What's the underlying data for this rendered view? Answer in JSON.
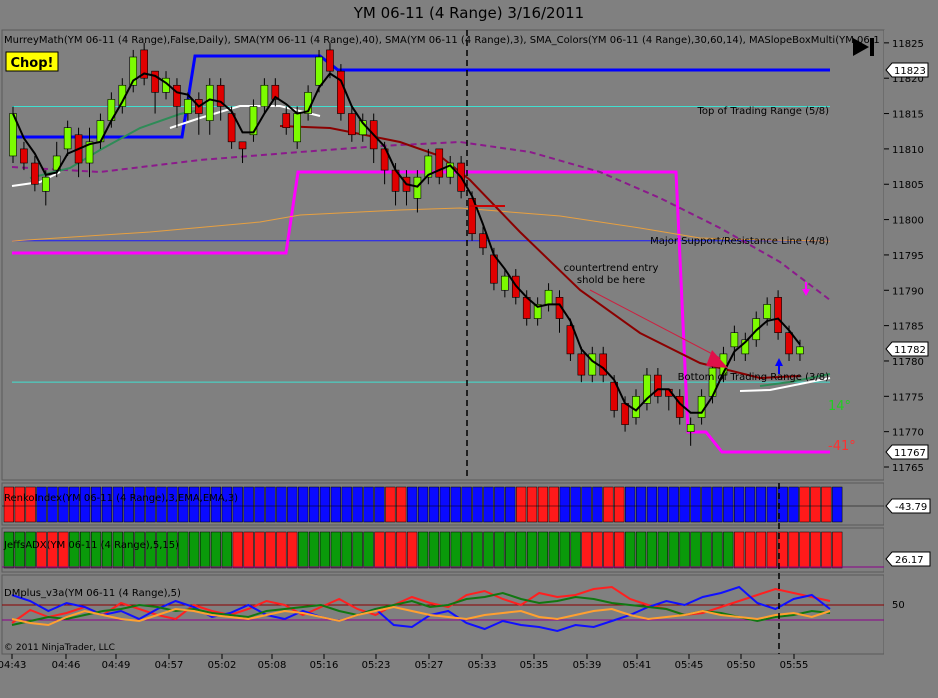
{
  "window": {
    "title": "YM 06-11 (4 Range)  3/16/2011"
  },
  "price_panel": {
    "indicator_label": "MurreyMath(YM 06-11 (4 Range),False,Daily), SMA(YM 06-11 (4 Range),40), SMA(YM 06-11 (4 Range),3), SMA_Colors(YM 06-11 (4 Range),30,60,14), MASlopeBoxMulti(YM 06-1",
    "chop_label": "Chop!",
    "top_range_label": "Top of Trading Range (5/8)",
    "major_sr_label": "Major Support/Resistance Line (4/8)",
    "bottom_range_label": "Bottom of Trading Range (3/8)",
    "annotation_line1": "countertrend entry",
    "annotation_line2": "shold be here",
    "slope_label_green": "14°",
    "slope_label_red": "-41°",
    "current_price_tags": [
      "11823",
      "11782",
      "11767"
    ]
  },
  "panel2": {
    "label": "RenkoIndex(YM 06-11 (4 Range),3,EMA,EMA,3)",
    "value_tag": "-43.79"
  },
  "panel3": {
    "label": "JeffsADX(YM 06-11 (4 Range),5,15)",
    "value_tag": "26.17"
  },
  "panel4": {
    "label": "DMplus_v3a(YM 06-11 (4 Range),5)",
    "scale_label": "50",
    "copyright": "© 2011 NinjaTrader, LLC"
  },
  "colors": {
    "background": "#808080",
    "up_candle": "#7CFC00",
    "down_candle": "#E00000",
    "murrey_blue": "#0000FF",
    "magenta": "#FF00FF",
    "cyan": "#40E0D0"
  },
  "chart_data": {
    "type": "candlestick",
    "title": "YM 06-11 (4 Range)  3/16/2011",
    "y_ticks": [
      11825,
      11820,
      11815,
      11810,
      11805,
      11800,
      11795,
      11790,
      11785,
      11780,
      11775,
      11770,
      11765
    ],
    "ylim": [
      11764,
      11828
    ],
    "x_ticks": [
      "04:43",
      "04:46",
      "04:49",
      "04:57",
      "05:02",
      "05:08",
      "05:16",
      "05:23",
      "05:27",
      "05:33",
      "05:35",
      "05:39",
      "05:41",
      "05:45",
      "05:50",
      "05:55"
    ],
    "levels": {
      "top_of_trading_range": 11816,
      "major_support_resistance": 11797,
      "bottom_of_trading_range": 11777
    },
    "bars": [
      {
        "o": 11809,
        "c": 11815,
        "h": 11816,
        "l": 11808
      },
      {
        "o": 11810,
        "c": 11808,
        "h": 11811,
        "l": 11807
      },
      {
        "o": 11808,
        "c": 11805,
        "h": 11809,
        "l": 11804
      },
      {
        "o": 11804,
        "c": 11806,
        "h": 11807,
        "l": 11802
      },
      {
        "o": 11807,
        "c": 11809,
        "h": 11811,
        "l": 11806
      },
      {
        "o": 11810,
        "c": 11813,
        "h": 11814,
        "l": 11809
      },
      {
        "o": 11812,
        "c": 11808,
        "h": 11813,
        "l": 11806
      },
      {
        "o": 11808,
        "c": 11811,
        "h": 11813,
        "l": 11806
      },
      {
        "o": 11811,
        "c": 11814,
        "h": 11815,
        "l": 11810
      },
      {
        "o": 11814,
        "c": 11817,
        "h": 11818,
        "l": 11813
      },
      {
        "o": 11816,
        "c": 11819,
        "h": 11820,
        "l": 11815
      },
      {
        "o": 11819,
        "c": 11823,
        "h": 11824,
        "l": 11818
      },
      {
        "o": 11824,
        "c": 11820,
        "h": 11825,
        "l": 11819
      },
      {
        "o": 11821,
        "c": 11818,
        "h": 11821,
        "l": 11815
      },
      {
        "o": 11818,
        "c": 11820,
        "h": 11821,
        "l": 11817
      },
      {
        "o": 11819,
        "c": 11816,
        "h": 11820,
        "l": 11813
      },
      {
        "o": 11815,
        "c": 11817,
        "h": 11818,
        "l": 11814
      },
      {
        "o": 11817,
        "c": 11815,
        "h": 11818,
        "l": 11812
      },
      {
        "o": 11814,
        "c": 11819,
        "h": 11820,
        "l": 11812
      },
      {
        "o": 11819,
        "c": 11816,
        "h": 11820,
        "l": 11814
      },
      {
        "o": 11815,
        "c": 11811,
        "h": 11816,
        "l": 11810
      },
      {
        "o": 11811,
        "c": 11810,
        "h": 11811,
        "l": 11808
      },
      {
        "o": 11812,
        "c": 11816,
        "h": 11817,
        "l": 11811
      },
      {
        "o": 11816,
        "c": 11819,
        "h": 11820,
        "l": 11815
      },
      {
        "o": 11819,
        "c": 11817,
        "h": 11820,
        "l": 11816
      },
      {
        "o": 11815,
        "c": 11813,
        "h": 11816,
        "l": 11812
      },
      {
        "o": 11811,
        "c": 11815,
        "h": 11816,
        "l": 11810
      },
      {
        "o": 11815,
        "c": 11818,
        "h": 11819,
        "l": 11814
      },
      {
        "o": 11819,
        "c": 11823,
        "h": 11824,
        "l": 11818
      },
      {
        "o": 11824,
        "c": 11821,
        "h": 11825,
        "l": 11820
      },
      {
        "o": 11821,
        "c": 11815,
        "h": 11822,
        "l": 11814
      },
      {
        "o": 11815,
        "c": 11812,
        "h": 11816,
        "l": 11811
      },
      {
        "o": 11812,
        "c": 11814,
        "h": 11815,
        "l": 11811
      },
      {
        "o": 11814,
        "c": 11810,
        "h": 11815,
        "l": 11808
      },
      {
        "o": 11810,
        "c": 11807,
        "h": 11811,
        "l": 11805
      },
      {
        "o": 11807,
        "c": 11804,
        "h": 11808,
        "l": 11802
      },
      {
        "o": 11806,
        "c": 11804,
        "h": 11807,
        "l": 11802
      },
      {
        "o": 11803,
        "c": 11806,
        "h": 11807,
        "l": 11801
      },
      {
        "o": 11806,
        "c": 11809,
        "h": 11810,
        "l": 11805
      },
      {
        "o": 11810,
        "c": 11806,
        "h": 11810,
        "l": 11805
      },
      {
        "o": 11806,
        "c": 11808,
        "h": 11809,
        "l": 11805
      },
      {
        "o": 11808,
        "c": 11804,
        "h": 11809,
        "l": 11803
      },
      {
        "o": 11803,
        "c": 11798,
        "h": 11804,
        "l": 11797
      },
      {
        "o": 11798,
        "c": 11796,
        "h": 11799,
        "l": 11795
      },
      {
        "o": 11795,
        "c": 11791,
        "h": 11796,
        "l": 11790
      },
      {
        "o": 11790,
        "c": 11792,
        "h": 11793,
        "l": 11789
      },
      {
        "o": 11792,
        "c": 11789,
        "h": 11793,
        "l": 11788
      },
      {
        "o": 11789,
        "c": 11786,
        "h": 11790,
        "l": 11785
      },
      {
        "o": 11786,
        "c": 11788,
        "h": 11789,
        "l": 11785
      },
      {
        "o": 11788,
        "c": 11790,
        "h": 11791,
        "l": 11787
      },
      {
        "o": 11789,
        "c": 11786,
        "h": 11790,
        "l": 11784
      },
      {
        "o": 11785,
        "c": 11781,
        "h": 11786,
        "l": 11780
      },
      {
        "o": 11781,
        "c": 11778,
        "h": 11782,
        "l": 11777
      },
      {
        "o": 11778,
        "c": 11781,
        "h": 11782,
        "l": 11777
      },
      {
        "o": 11781,
        "c": 11778,
        "h": 11782,
        "l": 11777
      },
      {
        "o": 11777,
        "c": 11773,
        "h": 11778,
        "l": 11772
      },
      {
        "o": 11774,
        "c": 11771,
        "h": 11775,
        "l": 11770
      },
      {
        "o": 11772,
        "c": 11775,
        "h": 11776,
        "l": 11771
      },
      {
        "o": 11774,
        "c": 11778,
        "h": 11779,
        "l": 11773
      },
      {
        "o": 11778,
        "c": 11775,
        "h": 11779,
        "l": 11774
      },
      {
        "o": 11776,
        "c": 11775,
        "h": 11776,
        "l": 11773
      },
      {
        "o": 11775,
        "c": 11772,
        "h": 11776,
        "l": 11771
      },
      {
        "o": 11770,
        "c": 11771,
        "h": 11772,
        "l": 11768
      },
      {
        "o": 11772,
        "c": 11775,
        "h": 11776,
        "l": 11771
      },
      {
        "o": 11775,
        "c": 11779,
        "h": 11780,
        "l": 11774
      },
      {
        "o": 11778,
        "c": 11781,
        "h": 11782,
        "l": 11777
      },
      {
        "o": 11782,
        "c": 11784,
        "h": 11785,
        "l": 11780
      },
      {
        "o": 11781,
        "c": 11783,
        "h": 11784,
        "l": 11780
      },
      {
        "o": 11783,
        "c": 11786,
        "h": 11787,
        "l": 11782
      },
      {
        "o": 11786,
        "c": 11788,
        "h": 11789,
        "l": 11785
      },
      {
        "o": 11789,
        "c": 11784,
        "h": 11790,
        "l": 11783
      },
      {
        "o": 11784,
        "c": 11781,
        "h": 11785,
        "l": 11780
      },
      {
        "o": 11781,
        "c": 11782,
        "h": 11783,
        "l": 11780
      }
    ],
    "renko_index_colors": "rrrbbbbbbbbbbbbbbbbbbbbbbbbbbbbbbbbrrbbbbbbbbbbrrrrbbbbrrbbbbbbbbbbbbbbbbrrrbbbbbbbbbbbbrrr",
    "adx_colors": "gggrrrgggggggggggggggrrrrrrgggggggrrrrgggggggggggggggrrrrggggggggggrrrrrrrrrrgggggrrrrrrrrrrr",
    "dm_red": [
      22,
      35,
      28,
      32,
      38,
      30,
      42,
      36,
      30,
      26,
      40,
      34,
      30,
      36,
      44,
      40,
      30,
      38,
      46,
      36,
      30,
      40,
      48,
      42,
      38,
      50,
      54,
      46,
      40,
      52,
      48,
      50,
      56,
      58,
      46,
      40,
      36,
      30,
      32,
      38,
      44,
      50,
      56,
      52,
      48,
      44
    ],
    "dm_blue": [
      50,
      44,
      34,
      42,
      38,
      30,
      34,
      26,
      36,
      44,
      38,
      28,
      32,
      40,
      30,
      26,
      34,
      28,
      24,
      30,
      36,
      20,
      18,
      30,
      34,
      22,
      16,
      24,
      20,
      18,
      14,
      20,
      18,
      24,
      30,
      38,
      44,
      40,
      48,
      52,
      58,
      42,
      36,
      46,
      50,
      36
    ],
    "dm_green": [
      20,
      24,
      28,
      26,
      30,
      34,
      36,
      40,
      38,
      34,
      36,
      32,
      30,
      28,
      34,
      36,
      38,
      40,
      34,
      30,
      36,
      40,
      44,
      38,
      40,
      46,
      48,
      52,
      46,
      42,
      44,
      48,
      46,
      42,
      40,
      38,
      36,
      30,
      34,
      32,
      28,
      24,
      28,
      30,
      34,
      32
    ],
    "dm_orange": [
      26,
      22,
      20,
      28,
      34,
      30,
      26,
      24,
      30,
      36,
      34,
      30,
      28,
      26,
      30,
      34,
      32,
      28,
      24,
      30,
      34,
      38,
      34,
      30,
      28,
      26,
      30,
      32,
      34,
      28,
      26,
      30,
      34,
      36,
      30,
      26,
      28,
      30,
      34,
      30,
      28,
      26,
      30,
      32,
      28,
      34
    ]
  }
}
